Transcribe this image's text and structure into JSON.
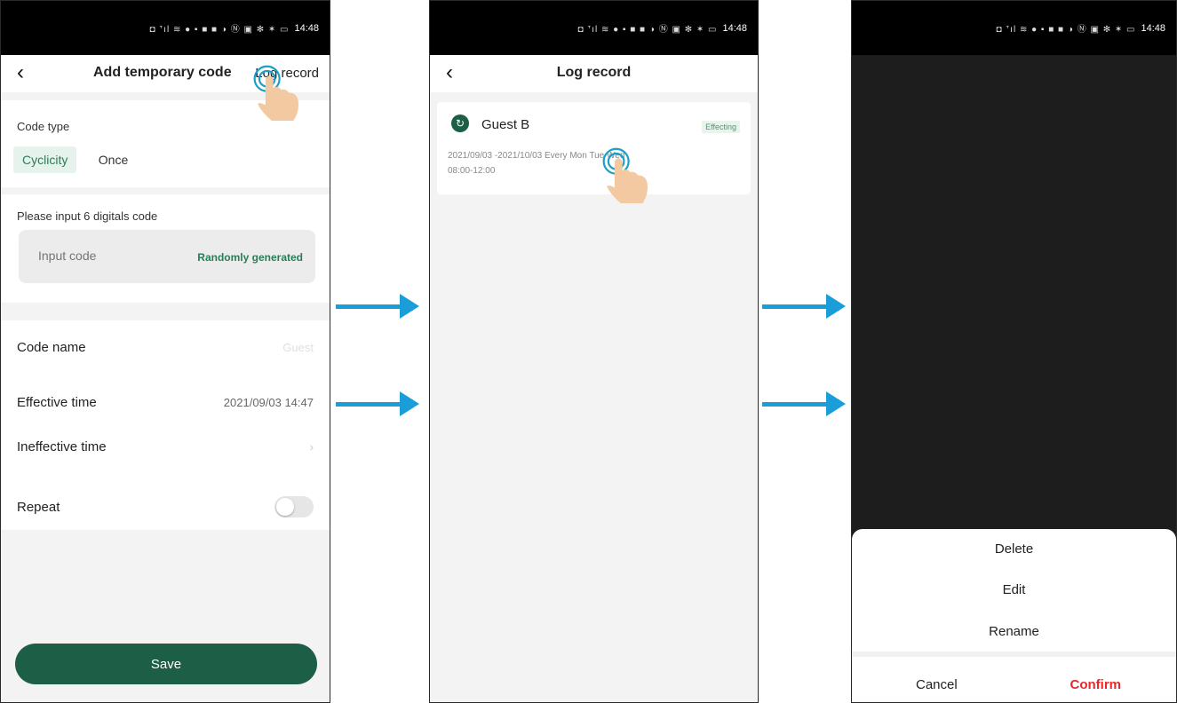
{
  "status": {
    "time": "14:48",
    "icons": "◘ ᐪıl ≋ ● ▪ ■ ■   ◑ Ⓝ ▣ ✻ ✶ ▭"
  },
  "screen1": {
    "title": "Add temporary code",
    "nav_link": "Log record",
    "code_type_label": "Code type",
    "type_cyclicity": "Cyclicity",
    "type_once": "Once",
    "input_label": "Please input 6 digitals code",
    "input_placeholder": "Input code",
    "random_label": "Randomly generated",
    "code_name_label": "Code name",
    "code_name_value": "Guest",
    "effective_label": "Effective time",
    "effective_value": "2021/09/03 14:47",
    "ineffective_label": "Ineffective time",
    "repeat_label": "Repeat",
    "save_label": "Save"
  },
  "screen2": {
    "title": "Log record",
    "guest_name": "Guest B",
    "badge": "Effecting",
    "desc_line1": "2021/09/03 -2021/10/03 Every Mon Tue Wed",
    "desc_line2": "08:00-12:00"
  },
  "screen3": {
    "delete": "Delete",
    "edit": "Edit",
    "rename": "Rename",
    "cancel": "Cancel",
    "confirm": "Confirm"
  },
  "colors": {
    "accent": "#1c5e46",
    "arrow": "#1a9dd8",
    "confirm": "#e8262b"
  }
}
